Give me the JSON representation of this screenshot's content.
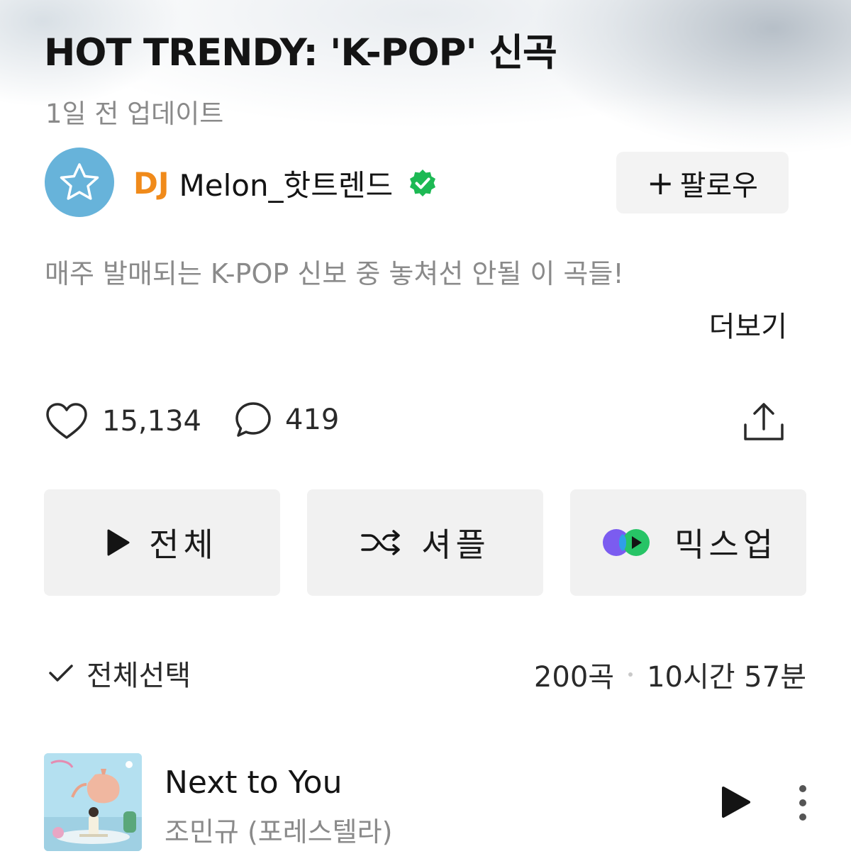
{
  "playlist": {
    "title": "HOT TRENDY: 'K-POP' 신곡",
    "updated": "1일 전 업데이트",
    "dj_prefix": "DJ",
    "dj_name": "Melon_핫트렌드",
    "follow_label": "팔로우",
    "description": "매주 발매되는 K-POP 신보 중 놓쳐선 안될 이 곡들!",
    "more_label": "더보기"
  },
  "stats": {
    "likes": "15,134",
    "comments": "419"
  },
  "actions": {
    "play_all": "전체",
    "shuffle": "셔플",
    "mixup": "믹스업"
  },
  "list_header": {
    "select_all": "전체선택",
    "song_count": "200곡",
    "duration": "10시간 57분"
  },
  "tracks": [
    {
      "title": "Next to You",
      "artist": "조민규 (포레스텔라)"
    }
  ],
  "colors": {
    "dj_accent": "#f08a1a",
    "avatar_bg": "#67b3da",
    "verified": "#1db954",
    "button_bg": "#f1f1f1"
  }
}
